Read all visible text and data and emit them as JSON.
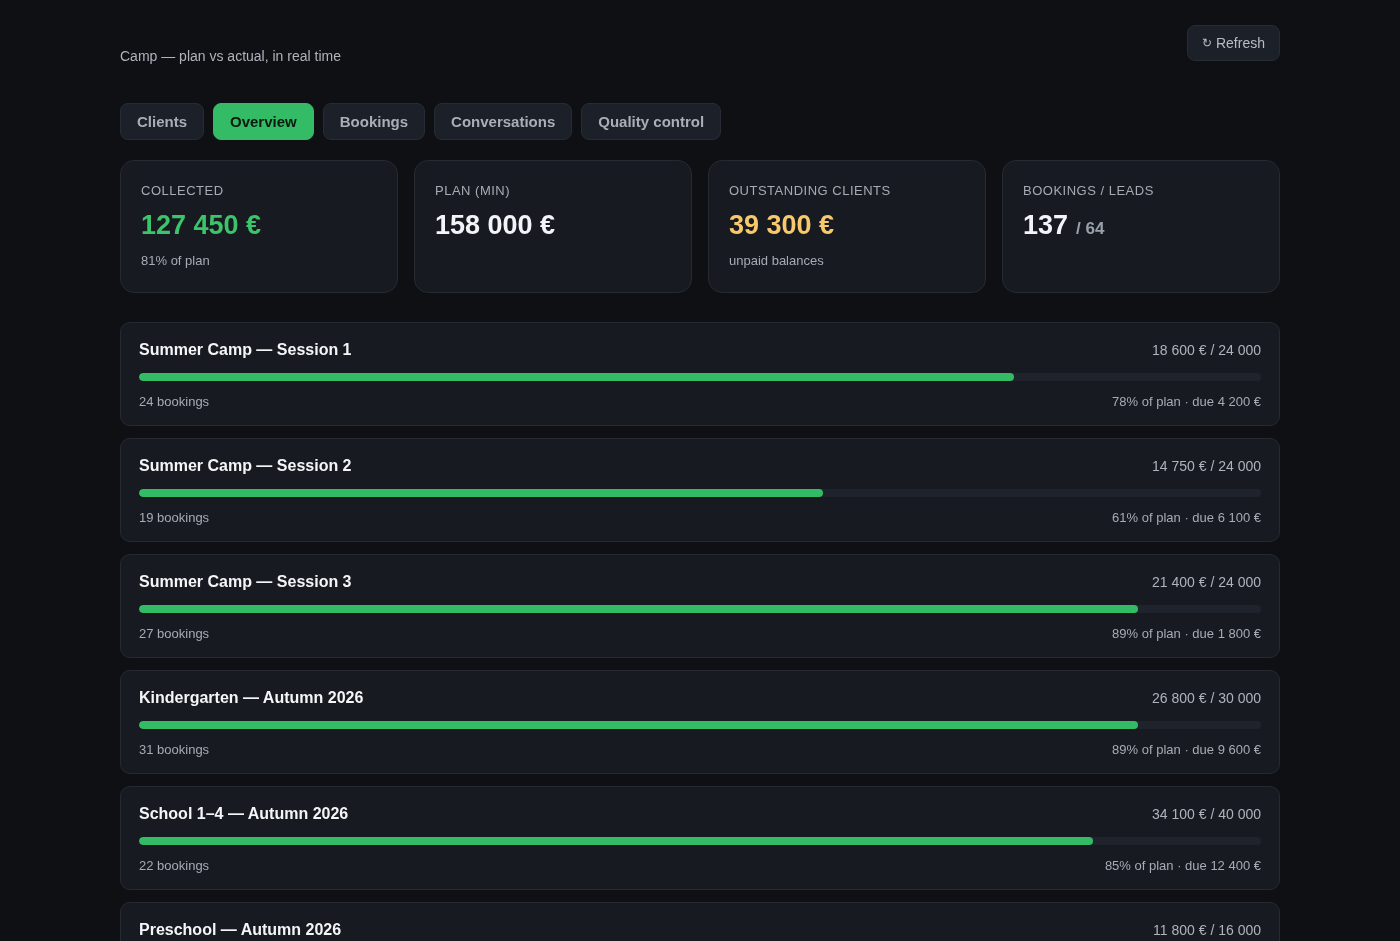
{
  "header": {
    "subtitle": "Camp — plan vs actual, in real time",
    "refresh": {
      "icon": "↻",
      "label": "Refresh"
    }
  },
  "tabs": [
    {
      "label": "Clients",
      "selected": false
    },
    {
      "label": "Overview",
      "selected": true
    },
    {
      "label": "Bookings",
      "selected": false
    },
    {
      "label": "Conversations",
      "selected": false
    },
    {
      "label": "Quality control",
      "selected": false
    }
  ],
  "stats": [
    {
      "label": "COLLECTED",
      "value": "127 450 €",
      "color": "#3cc46a",
      "note": "81% of plan"
    },
    {
      "label": "PLAN (MIN)",
      "value": "158 000 €",
      "color": "#f2f4f7"
    },
    {
      "label": "OUTSTANDING CLIENTS",
      "value": "39 300 €",
      "color": "#f7c96a",
      "note": "unpaid balances"
    },
    {
      "label": "BOOKINGS / LEADS",
      "value": "137",
      "color": "#f2f4f7",
      "suffix": "/ 64"
    }
  ],
  "projects": [
    {
      "title": "Summer Camp — Session 1",
      "amount": "18 600 € / 24 000",
      "level": 0.78,
      "bookings": "24 bookings",
      "summary": "78% of plan · due 4 200 €"
    },
    {
      "title": "Summer Camp — Session 2",
      "amount": "14 750 € / 24 000",
      "level": 0.61,
      "bookings": "19 bookings",
      "summary": "61% of plan · due 6 100 €"
    },
    {
      "title": "Summer Camp — Session 3",
      "amount": "21 400 € / 24 000",
      "level": 0.89,
      "bookings": "27 bookings",
      "summary": "89% of plan · due 1 800 €"
    },
    {
      "title": "Kindergarten — Autumn 2026",
      "amount": "26 800 € / 30 000",
      "level": 0.89,
      "bookings": "31 bookings",
      "summary": "89% of plan · due 9 600 €"
    },
    {
      "title": "School 1–4 — Autumn 2026",
      "amount": "34 100 € / 40 000",
      "level": 0.85,
      "bookings": "22 bookings",
      "summary": "85% of plan · due 12 400 €"
    },
    {
      "title": "Preschool — Autumn 2026",
      "amount": "11 800 € / 16 000"
    }
  ]
}
